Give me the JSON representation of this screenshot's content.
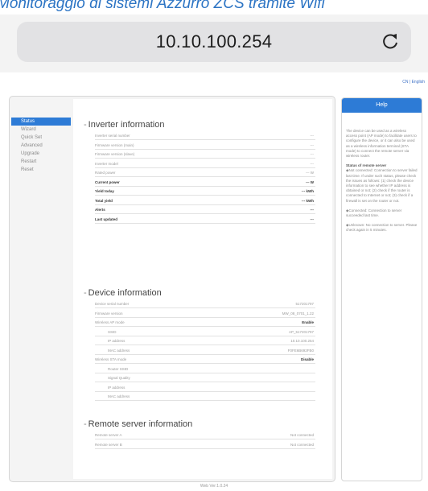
{
  "caption": "Monitoraggio di sistemi Azzurro ZCS tramite Wifi",
  "browser": {
    "url": "10.10.100.254",
    "reload_icon": "reload-icon"
  },
  "lang_links": "CN | English",
  "nav": [
    {
      "label": "Status",
      "active": true
    },
    {
      "label": "Wizard",
      "active": false
    },
    {
      "label": "Quick Set",
      "active": false
    },
    {
      "label": "Advanced",
      "active": false
    },
    {
      "label": "Upgrade",
      "active": false
    },
    {
      "label": "Restart",
      "active": false
    },
    {
      "label": "Reset",
      "active": false
    }
  ],
  "inverter": {
    "title": "Inverter information",
    "rows": [
      {
        "label": "Inverter serial number",
        "value": "---"
      },
      {
        "label": "Firmware version (main)",
        "value": "---"
      },
      {
        "label": "Firmware version (slave)",
        "value": "---"
      },
      {
        "label": "Inverter model",
        "value": "---"
      },
      {
        "label": "Rated power",
        "value": "--- W"
      },
      {
        "label": "Current power",
        "value": "--- W",
        "bold": true
      },
      {
        "label": "Yield today",
        "value": "--- kWh",
        "bold": true
      },
      {
        "label": "Total yield",
        "value": "--- kWh",
        "bold": true
      },
      {
        "label": "Alerts",
        "value": "---",
        "bold": true
      },
      {
        "label": "Last updated",
        "value": "---",
        "bold": true
      }
    ]
  },
  "device": {
    "title": "Device information",
    "rows": [
      {
        "label": "Device serial number",
        "value": "517201797"
      },
      {
        "label": "Firmware version",
        "value": "MW_08_0701_1.22"
      },
      {
        "label": "Wireless AP mode",
        "value": "Enable",
        "strong_value": true
      },
      {
        "label": "SSID",
        "value": "AP_517201797",
        "indent": true
      },
      {
        "label": "IP address",
        "value": "10.10.100.254",
        "indent": true
      },
      {
        "label": "MAC address",
        "value": "F0FE6B692FB0",
        "indent": true
      },
      {
        "label": "Wireless STA mode",
        "value": "Disable",
        "strong_value": true
      },
      {
        "label": "Router SSID",
        "value": "",
        "indent": true
      },
      {
        "label": "Signal Quality",
        "value": "",
        "indent": true
      },
      {
        "label": "IP address",
        "value": "",
        "indent": true
      },
      {
        "label": "MAC address",
        "value": "",
        "indent": true
      }
    ]
  },
  "remote": {
    "title": "Remote server information",
    "rows": [
      {
        "label": "Remote server A",
        "value": "Not connected"
      },
      {
        "label": "Remote server B",
        "value": "Not connected"
      }
    ]
  },
  "help": {
    "title": "Help",
    "paragraphs": [
      {
        "text": "The device can be used as a wireless access point (AP mode) to facilitate users to configure the device, or it can also be used as a wireless information terminal (STA mode) to connect the remote server via wireless router.",
        "strong": false
      },
      {
        "text": "Status of remote server",
        "strong": true
      },
      {
        "text": "◆Not connected: Connection to server failed last time. If under such status, please check the issues as follows: (1) check the device information to see whether IP address is obtained or not; (2) check if the router is connected to Internet or not; (3) check if a firewall is set on the router or not.",
        "strong": false
      },
      {
        "text": "◆Connected: Connection to server succeeded last time.",
        "strong": false
      },
      {
        "text": "◆Unknown: No connection to server. Please check again in 5 minutes.",
        "strong": false
      }
    ]
  },
  "footer": "Web Ver:1.0.24"
}
